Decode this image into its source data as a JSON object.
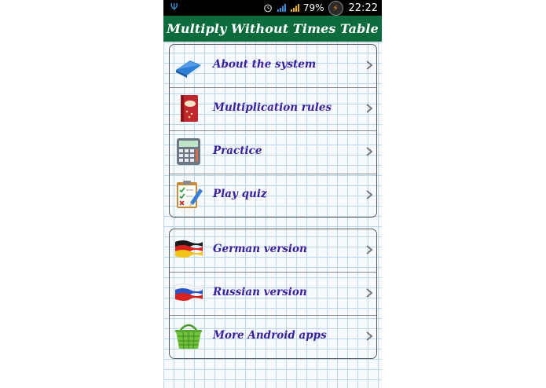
{
  "status_bar": {
    "usb_icon": "usb-icon",
    "alarm_icon": "alarm-icon",
    "battery_percent": "79%",
    "time": "22:22"
  },
  "app": {
    "title": "Multiply Without Times Table"
  },
  "menu_group_1": [
    {
      "label": "About the system",
      "icon": "book-icon"
    },
    {
      "label": "Multiplication rules",
      "icon": "rules-book-icon"
    },
    {
      "label": "Practice",
      "icon": "calculator-icon"
    },
    {
      "label": "Play quiz",
      "icon": "quiz-checklist-icon"
    }
  ],
  "menu_group_2": [
    {
      "label": "German version",
      "icon": "german-flag-icon"
    },
    {
      "label": "Russian version",
      "icon": "russian-flag-icon"
    },
    {
      "label": "More Android apps",
      "icon": "basket-icon"
    }
  ],
  "colors": {
    "title_bar": "#0b6b3d",
    "label_text": "#3a20a0",
    "grid_line": "#bcd6ec"
  }
}
